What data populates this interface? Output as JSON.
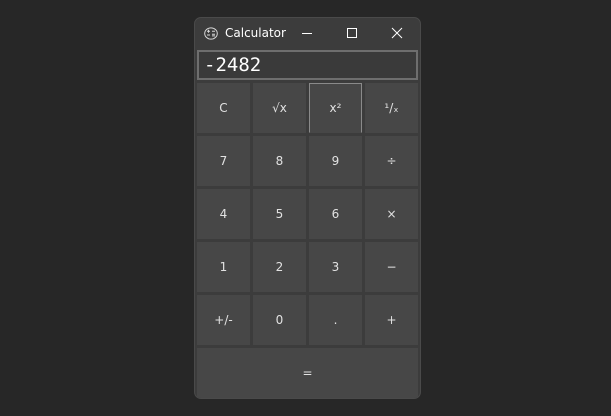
{
  "window": {
    "title": "Calculator"
  },
  "display": {
    "value": "-2482"
  },
  "keys": {
    "clear": "C",
    "sqrt": "√x",
    "square": "x²",
    "reciprocal": "¹/ₓ",
    "seven": "7",
    "eight": "8",
    "nine": "9",
    "divide": "÷",
    "four": "4",
    "five": "5",
    "six": "6",
    "multiply": "×",
    "one": "1",
    "two": "2",
    "three": "3",
    "minus": "−",
    "negate": "+/-",
    "zero": "0",
    "decimal": ".",
    "plus": "+",
    "equals": "="
  },
  "icons": {
    "app": "calculator-icon",
    "minimize": "minimize-icon",
    "maximize": "maximize-icon",
    "close": "close-icon"
  }
}
